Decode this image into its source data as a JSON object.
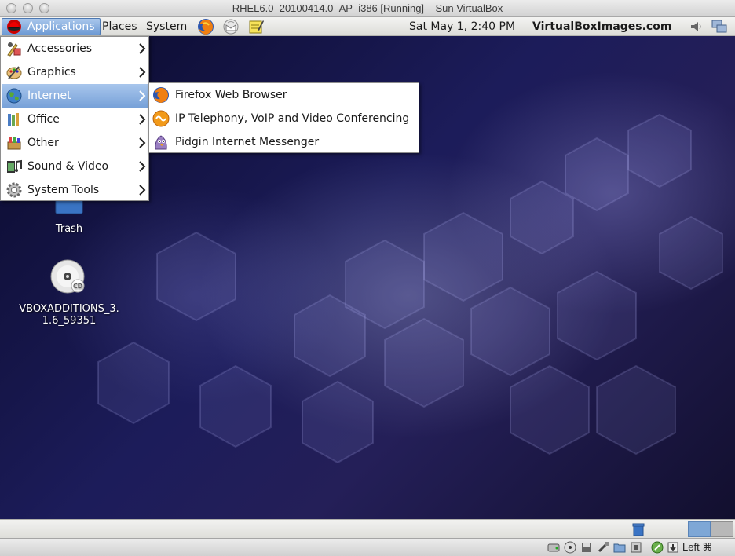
{
  "window": {
    "title": "RHEL6.0–20100414.0–AP–i386 [Running] – Sun VirtualBox"
  },
  "top_panel": {
    "menus": {
      "applications": "Applications",
      "places": "Places",
      "system": "System"
    },
    "launchers": [
      "firefox-icon",
      "evolution-mail-icon",
      "notes-editor-icon"
    ],
    "clock": "Sat May  1,  2:40 PM",
    "website": "VirtualBoxImages.com",
    "tray": [
      "volume-icon",
      "network-icon"
    ]
  },
  "applications_menu": {
    "items": [
      {
        "label": "Accessories",
        "icon": "accessories-icon"
      },
      {
        "label": "Graphics",
        "icon": "graphics-icon"
      },
      {
        "label": "Internet",
        "icon": "internet-globe-icon",
        "active": true
      },
      {
        "label": "Office",
        "icon": "office-icon"
      },
      {
        "label": "Other",
        "icon": "other-icon"
      },
      {
        "label": "Sound & Video",
        "icon": "sound-video-icon"
      },
      {
        "label": "System Tools",
        "icon": "system-tools-icon"
      }
    ]
  },
  "internet_submenu": {
    "items": [
      {
        "label": "Firefox Web Browser",
        "icon": "firefox-icon"
      },
      {
        "label": "IP Telephony, VoIP and Video Conferencing",
        "icon": "ekiga-icon"
      },
      {
        "label": "Pidgin Internet Messenger",
        "icon": "pidgin-icon"
      }
    ]
  },
  "desktop": {
    "icons": [
      {
        "label": "Trash",
        "icon": "trash-icon"
      },
      {
        "label_line1": "VBOXADDITIONS_3.",
        "label_line2": "1.6_59351",
        "icon": "cd-icon",
        "badge": "CD"
      }
    ]
  },
  "status_bar": {
    "host_key": "Left ⌘"
  },
  "colors": {
    "menu_highlight": "#77a1d8",
    "desktop_base": "#1c1c5a"
  }
}
